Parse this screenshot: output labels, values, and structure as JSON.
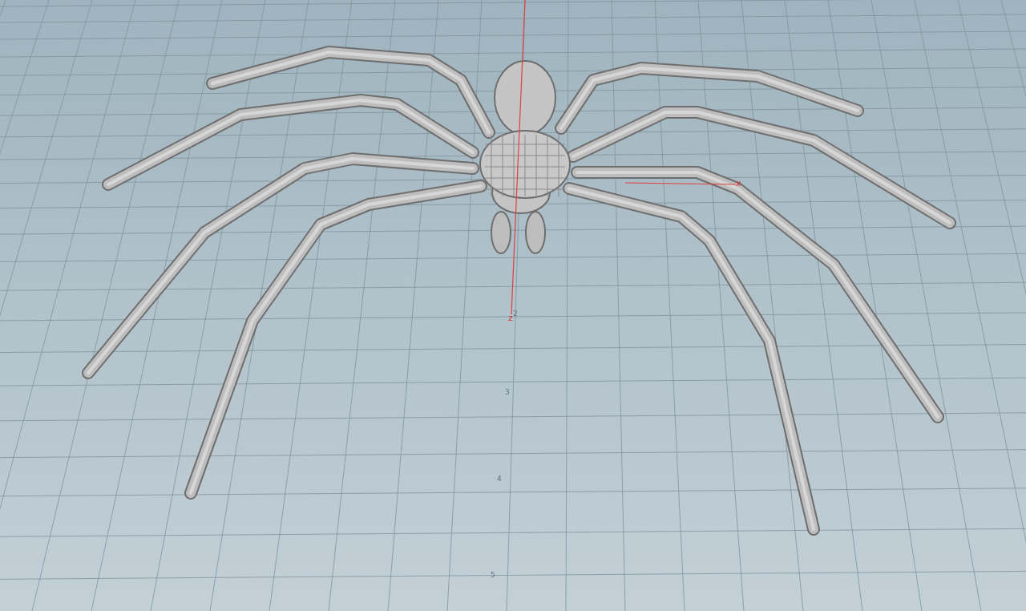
{
  "viewport": {
    "axis_labels": [
      "x",
      "z"
    ],
    "grid_labels": [
      "2",
      "3",
      "4",
      "5"
    ]
  }
}
